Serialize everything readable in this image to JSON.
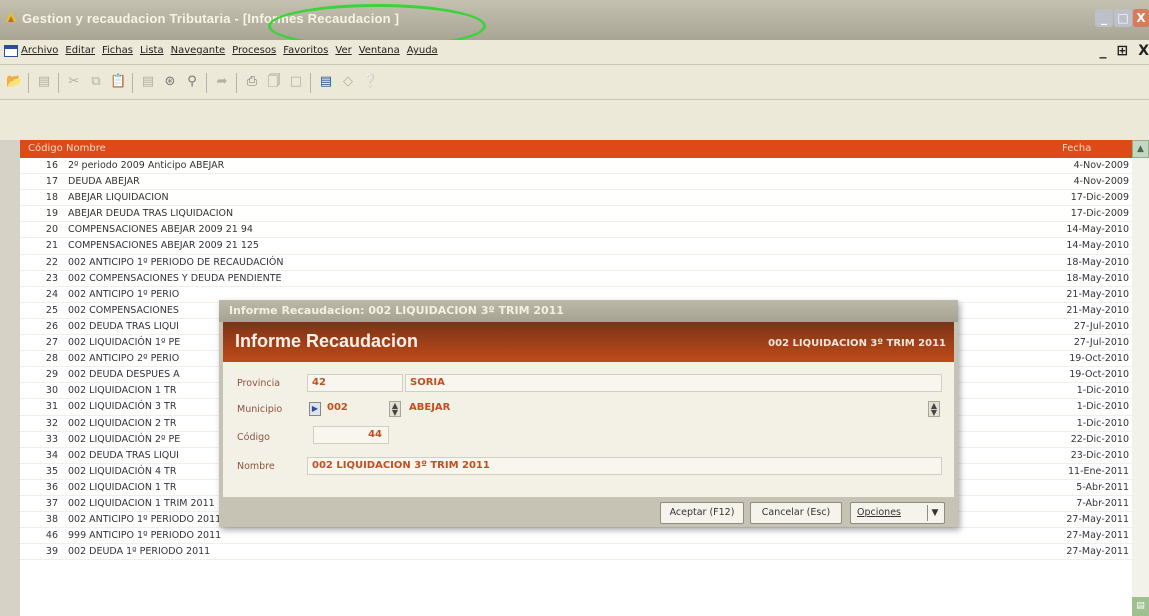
{
  "window": {
    "title": "Gestion y recaudacion Tributaria - [Informes Recaudacion ]"
  },
  "menu": [
    "Archivo",
    "Editar",
    "Fichas",
    "Lista",
    "Navegante",
    "Procesos",
    "Favoritos",
    "Ver",
    "Ventana",
    "Ayuda"
  ],
  "mdi_buttons": [
    "_",
    "̅□",
    "X"
  ],
  "grid": {
    "columns": {
      "codigo": "Código",
      "nombre": "Nombre",
      "fecha": "Fecha"
    },
    "rows": [
      {
        "codigo": "16",
        "nombre": "2º periodo 2009 Anticipo ABEJAR",
        "fecha": "4-Nov-2009"
      },
      {
        "codigo": "17",
        "nombre": "DEUDA ABEJAR",
        "fecha": "4-Nov-2009"
      },
      {
        "codigo": "18",
        "nombre": "ABEJAR LIQUIDACION",
        "fecha": "17-Dic-2009"
      },
      {
        "codigo": "19",
        "nombre": "ABEJAR DEUDA TRAS LIQUIDACION",
        "fecha": "17-Dic-2009"
      },
      {
        "codigo": "20",
        "nombre": "COMPENSACIONES ABEJAR 2009 21 94",
        "fecha": "14-May-2010"
      },
      {
        "codigo": "21",
        "nombre": "COMPENSACIONES ABEJAR 2009 21 125",
        "fecha": "14-May-2010"
      },
      {
        "codigo": "22",
        "nombre": "002 ANTICIPO 1º PERIODO DE RECAUDACIÓN",
        "fecha": "18-May-2010"
      },
      {
        "codigo": "23",
        "nombre": "002 COMPENSACIONES Y DEUDA PENDIENTE",
        "fecha": "18-May-2010"
      },
      {
        "codigo": "24",
        "nombre": "002 ANTICIPO 1º PERIO",
        "fecha": "21-May-2010"
      },
      {
        "codigo": "25",
        "nombre": "002 COMPENSACIONES",
        "fecha": "21-May-2010"
      },
      {
        "codigo": "26",
        "nombre": "002 DEUDA TRAS LIQUI",
        "fecha": "27-Jul-2010"
      },
      {
        "codigo": "27",
        "nombre": "002 LIQUIDACIÓN 1º PE",
        "fecha": "27-Jul-2010"
      },
      {
        "codigo": "28",
        "nombre": "002 ANTICIPO 2º PERIO",
        "fecha": "19-Oct-2010"
      },
      {
        "codigo": "29",
        "nombre": "002 DEUDA DESPUES A",
        "fecha": "19-Oct-2010"
      },
      {
        "codigo": "30",
        "nombre": "002 LIQUIDACION 1 TR",
        "fecha": "1-Dic-2010"
      },
      {
        "codigo": "31",
        "nombre": "002 LIQUIDACIÓN 3 TR",
        "fecha": "1-Dic-2010"
      },
      {
        "codigo": "32",
        "nombre": "002 LIQUIDACION 2 TR",
        "fecha": "1-Dic-2010"
      },
      {
        "codigo": "33",
        "nombre": "002 LIQUIDACIÓN 2º PE",
        "fecha": "22-Dic-2010"
      },
      {
        "codigo": "34",
        "nombre": "002 DEUDA TRAS LIQUI",
        "fecha": "23-Dic-2010"
      },
      {
        "codigo": "35",
        "nombre": "002 LIQUIDACIÓN 4 TR",
        "fecha": "11-Ene-2011"
      },
      {
        "codigo": "36",
        "nombre": "002 LIQUIDACION 1 TR",
        "fecha": "5-Abr-2011"
      },
      {
        "codigo": "37",
        "nombre": "002 LIQUIDACION 1 TRIM 2011",
        "fecha": "7-Abr-2011"
      },
      {
        "codigo": "38",
        "nombre": "002 ANTICIPO 1º PERIODO 2011",
        "fecha": "27-May-2011"
      },
      {
        "codigo": "46",
        "nombre": "999 ANTICIPO 1º PERIODO 2011",
        "fecha": "27-May-2011"
      },
      {
        "codigo": "39",
        "nombre": "002 DEUDA 1º PERIODO 2011",
        "fecha": "27-May-2011"
      }
    ]
  },
  "dialog": {
    "title": "Informe Recaudacion: 002 LIQUIDACION 3º TRIM 2011",
    "heading": "Informe Recaudacion",
    "subheading": "002 LIQUIDACION 3º TRIM 2011",
    "provincia": {
      "label": "Provincia",
      "code": "42",
      "name": "SORIA"
    },
    "municipio": {
      "label": "Municipio",
      "code": "002",
      "name": "ABEJAR"
    },
    "codigo": {
      "label": "Código",
      "value": "44"
    },
    "nombre": {
      "label": "Nombre",
      "value": "002 LIQUIDACION 3º TRIM 2011"
    },
    "buttons": {
      "aceptar": "Aceptar (F12)",
      "cancelar": "Cancelar (Esc)",
      "opciones": "Opciones"
    }
  },
  "colors": {
    "accent": "#dd4a18",
    "banner": "#b0461a",
    "highlight_ellipse": "#3ad33a"
  }
}
